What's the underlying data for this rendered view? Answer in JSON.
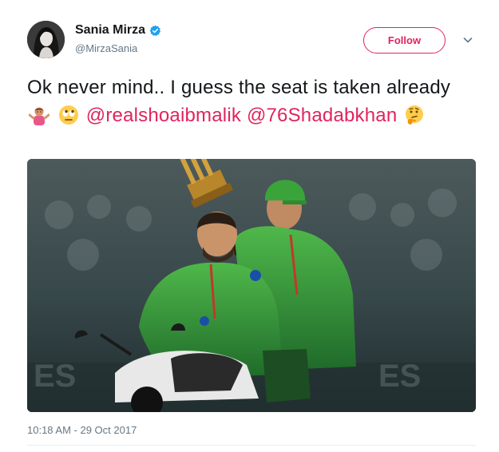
{
  "user": {
    "display_name": "Sania Mirza",
    "handle": "@MirzaSania",
    "verified": true
  },
  "actions": {
    "follow_label": "Follow",
    "more_icon": "chevron-down-icon"
  },
  "tweet": {
    "text_part1": "Ok never mind.. I guess the seat is taken already",
    "emoji_1": "person-shrugging-emoji",
    "emoji_2": "face-with-rolling-eyes-emoji",
    "mention_1": "@realshoaibmalik",
    "mention_2": "@76Shadabkhan",
    "emoji_3": "thinking-face-emoji"
  },
  "timestamp": "10:18 AM - 29 Oct 2017",
  "colors": {
    "accent": "#e0245e",
    "verified": "#1da1f2",
    "secondary_text": "#657786",
    "jersey_green": "#3ea33a"
  }
}
